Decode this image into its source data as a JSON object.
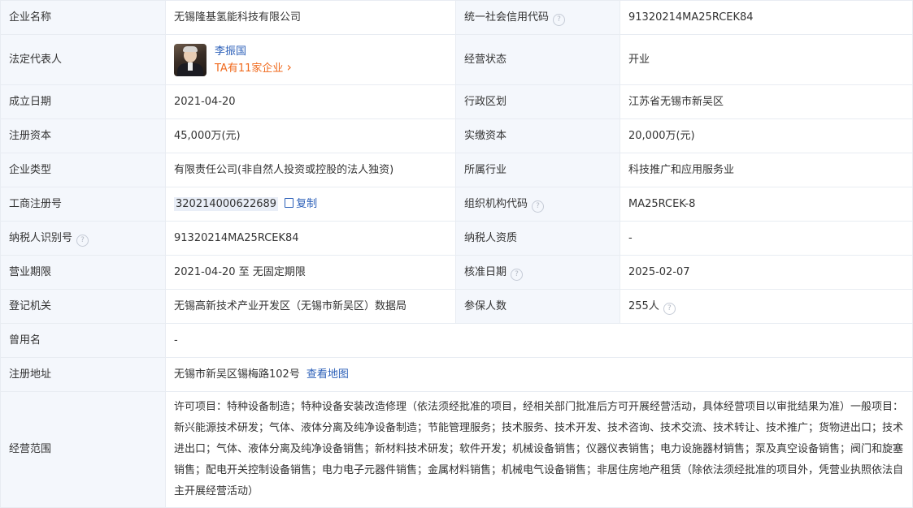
{
  "rows": {
    "company_name": {
      "label": "企业名称",
      "value": "无锡隆基氢能科技有限公司"
    },
    "credit_code": {
      "label": "统一社会信用代码",
      "value": "91320214MA25RCEK84"
    },
    "legal_rep": {
      "label": "法定代表人",
      "name": "李振国",
      "count_text": "TA有11家企业",
      "chevron": "›"
    },
    "status": {
      "label": "经营状态",
      "value": "开业"
    },
    "founded": {
      "label": "成立日期",
      "value": "2021-04-20"
    },
    "region": {
      "label": "行政区划",
      "value": "江苏省无锡市新吴区"
    },
    "reg_capital": {
      "label": "注册资本",
      "value": "45,000万(元)"
    },
    "paid_capital": {
      "label": "实缴资本",
      "value": "20,000万(元)"
    },
    "company_type": {
      "label": "企业类型",
      "value": "有限责任公司(非自然人投资或控股的法人独资)"
    },
    "industry": {
      "label": "所属行业",
      "value": "科技推广和应用服务业"
    },
    "reg_number": {
      "label": "工商注册号",
      "value": "320214000622689",
      "copy": "复制"
    },
    "org_code": {
      "label": "组织机构代码",
      "value": "MA25RCEK-8"
    },
    "taxpayer_id": {
      "label": "纳税人识别号",
      "value": "91320214MA25RCEK84"
    },
    "taxpayer_qual": {
      "label": "纳税人资质",
      "value": "-"
    },
    "term": {
      "label": "营业期限",
      "value": "2021-04-20 至 无固定期限"
    },
    "approval_date": {
      "label": "核准日期",
      "value": "2025-02-07"
    },
    "authority": {
      "label": "登记机关",
      "value": "无锡高新技术产业开发区（无锡市新吴区）数据局"
    },
    "insured": {
      "label": "参保人数",
      "value": "255人"
    },
    "former_name": {
      "label": "曾用名",
      "value": "-"
    },
    "address": {
      "label": "注册地址",
      "value": "无锡市新吴区锡梅路102号",
      "map_link": "查看地图"
    },
    "scope": {
      "label": "经营范围",
      "value": "许可项目：特种设备制造；特种设备安装改造修理（依法须经批准的项目，经相关部门批准后方可开展经营活动，具体经营项目以审批结果为准）一般项目：新兴能源技术研发；气体、液体分离及纯净设备制造；节能管理服务；技术服务、技术开发、技术咨询、技术交流、技术转让、技术推广；货物进出口；技术进出口；气体、液体分离及纯净设备销售；新材料技术研发；软件开发；机械设备销售；仪器仪表销售；电力设施器材销售；泵及真空设备销售；阀门和旋塞销售；配电开关控制设备销售；电力电子元器件销售；金属材料销售；机械电气设备销售；非居住房地产租赁（除依法须经批准的项目外，凭营业执照依法自主开展经营活动）"
    }
  },
  "help_icon_glyph": "?",
  "icons": {
    "help": "question-circle-icon",
    "copy": "copy-icon",
    "chevron": "chevron-right-icon"
  },
  "colors": {
    "label_bg": "#f4f7fc",
    "border": "#e8ecf2",
    "link": "#2b5fb8",
    "highlight_orange": "#f06a1d"
  }
}
